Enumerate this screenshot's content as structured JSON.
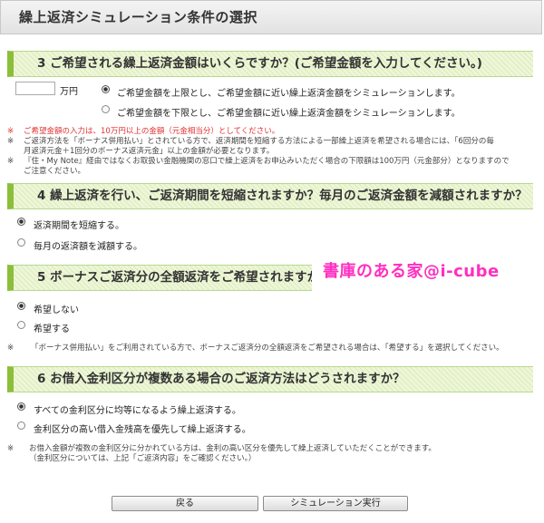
{
  "page_title": "繰上返済シミュレーション条件の選択",
  "section3": {
    "header": "3  ご希望される繰上返済金額はいくらですか？(ご希望金額を入力してください。)",
    "amount_value": "",
    "unit": "万円",
    "options": [
      {
        "label": "ご希望金額を上限とし、ご希望金額に近い繰上返済金額をシミュレーションします。",
        "checked": true
      },
      {
        "label": "ご希望金額を下限とし、ご希望金額に近い繰上返済金額をシミュレーションします。",
        "checked": false
      }
    ],
    "notes": [
      {
        "mark": "※",
        "lines": [
          "ご希望金額の入力は、10万円以上の金額（元金相当分）としてください。"
        ],
        "color": "#e03030"
      },
      {
        "mark": "※",
        "lines": [
          "ご返済方法を「ボーナス併用払い」とされている方で、返済期間を短縮する方法による一部繰上返済を希望される場合には、「6回分の毎",
          "月返済元金＋1回分のボーナス返済元金」以上の金額が必要となります。"
        ],
        "color": "#444444"
      },
      {
        "mark": "※",
        "lines": [
          "『住・My Note』経由ではなくお取扱い金融機関の窓口で繰上返済をお申込みいただく場合の下限額は100万円（元金部分）となりますので",
          "ご注意ください。"
        ],
        "color": "#444444"
      }
    ]
  },
  "section4": {
    "header": "4  繰上返済を行い、ご返済期間を短縮されますか？毎月のご返済金額を減額されますか？",
    "options": [
      {
        "label": "返済期間を短縮する。",
        "checked": true
      },
      {
        "label": "毎月の返済額を減額する。",
        "checked": false
      }
    ]
  },
  "section5": {
    "header": "5  ボーナスご返済分の全額返済をご希望されますか？",
    "options": [
      {
        "label": "希望しない",
        "checked": true
      },
      {
        "label": "希望する",
        "checked": false
      }
    ],
    "notes": [
      {
        "mark": "※",
        "lines": [
          "「ボーナス併用払い」をご利用されている方で、ボーナスご返済分の全額返済をご希望される場合は、「希望する」を選択してください。"
        ]
      }
    ]
  },
  "section6": {
    "header": "6  お借入金利区分が複数ある場合のご返済方法はどうされますか？",
    "options": [
      {
        "label": "すべての金利区分に均等になるよう繰上返済する。",
        "checked": true
      },
      {
        "label": "金利区分の高い借入金残高を優先して繰上返済する。",
        "checked": false
      }
    ],
    "notes": [
      {
        "mark": "※",
        "lines": [
          "お借入金額が複数の金利区分に分かれている方は、金利の高い区分を優先して繰上返済していただくことができます。",
          "（金利区分については、上記「ご返済内容」をご確認ください。）"
        ]
      }
    ]
  },
  "watermark": "書庫のある家@i-cube",
  "buttons": {
    "back": "戻る",
    "run": "シミュレーション実行"
  },
  "colors": {
    "header_accent": "#8bbf3a",
    "note_red": "#e03030",
    "watermark": "#ff2fc0"
  }
}
